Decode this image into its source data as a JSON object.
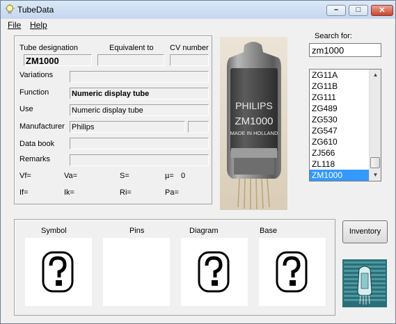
{
  "window": {
    "title": "TubeData"
  },
  "menu": {
    "file": "File",
    "help": "Help"
  },
  "info": {
    "tube_designation_label": "Tube designation",
    "equivalent_label": "Equivalent to",
    "cv_label": "CV number",
    "tube_designation": "ZM1000",
    "equivalent": "",
    "cv_number": "",
    "variations_label": "Variations",
    "variations": "",
    "function_label": "Function",
    "function": "Numeric display tube",
    "use_label": "Use",
    "use": "Numeric display tube",
    "manufacturer_label": "Manufacturer",
    "manufacturer": "Philips",
    "manufacturer_extra": "",
    "databook_label": "Data book",
    "databook": "",
    "remarks_label": "Remarks",
    "remarks": "",
    "vf": "Vf=",
    "va": "Va=",
    "s": "S=",
    "mu": "µ=",
    "mu_value": "0",
    "if": "If=",
    "ik": "Ik=",
    "ri": "Ri=",
    "pa": "Pa="
  },
  "photo": {
    "brand": "PHILIPS",
    "model": "ZM1000",
    "origin": "MADE IN HOLLAND"
  },
  "search": {
    "label": "Search for:",
    "value": "zm1000"
  },
  "list": {
    "items": [
      "ZG11A",
      "ZG11B",
      "ZG111",
      "ZG489",
      "ZG530",
      "ZG547",
      "ZG610",
      "ZJ566",
      "ZL118",
      "ZM1000"
    ],
    "selected": "ZM1000"
  },
  "images": {
    "symbol": "Symbol",
    "pins": "Pins",
    "diagram": "Diagram",
    "base": "Base"
  },
  "buttons": {
    "inventory": "Inventory"
  },
  "colors": {
    "selection": "#3399ff",
    "titlebar": "#c4d7ee",
    "close": "#c9452f"
  },
  "icons": {
    "app": "lightbulb-icon",
    "placeholder": "question-mark-icon"
  }
}
